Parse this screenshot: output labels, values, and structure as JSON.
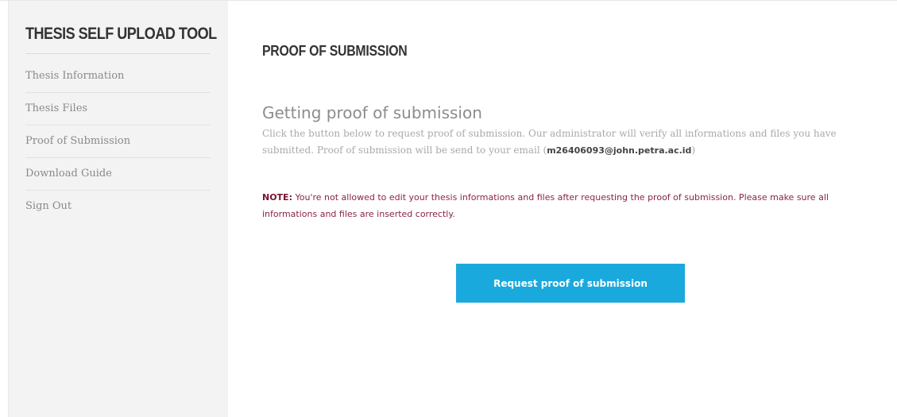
{
  "sidebar": {
    "title": "THESIS SELF UPLOAD TOOL",
    "items": [
      {
        "label": "Thesis Information"
      },
      {
        "label": "Thesis Files"
      },
      {
        "label": "Proof of Submission"
      },
      {
        "label": "Download Guide"
      },
      {
        "label": "Sign Out"
      }
    ]
  },
  "main": {
    "page_title": "PROOF OF SUBMISSION",
    "section_heading": "Getting proof of submission",
    "description_text": "Click the button below to request proof of submission. Our administrator will verify all informations and files you have submitted. Proof of submission will be send to your email (",
    "email": "m26406093@john.petra.ac.id",
    "description_close": ")",
    "note_label": "NOTE:",
    "note_text": " You're not allowed to edit your thesis informations and files after requesting the proof of submission. Please make sure all informations and files are inserted correctly.",
    "button_label": "Request proof of submission"
  },
  "colors": {
    "sidebar_bg": "#f3f3f3",
    "button_bg": "#1aa9dd",
    "note_color": "#8a2541"
  }
}
